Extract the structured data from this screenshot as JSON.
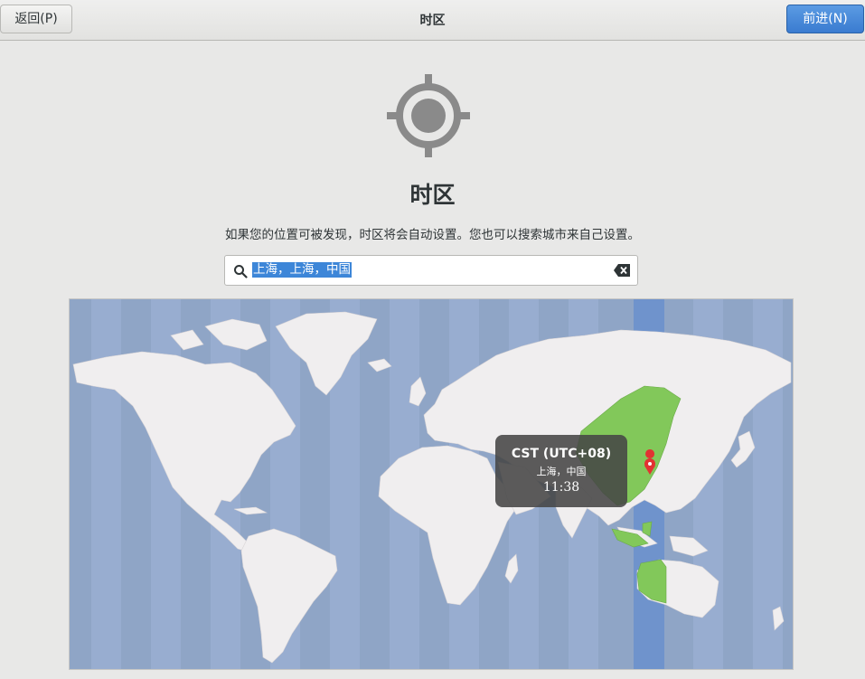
{
  "header": {
    "back_label": "返回(P)",
    "title": "时区",
    "next_label": "前进(N)"
  },
  "main": {
    "title": "时区",
    "description": "如果您的位置可被发现，时区将会自动设置。您也可以搜索城市来自己设置。",
    "search": {
      "value": "上海，上海，中国"
    }
  },
  "map": {
    "selected_timezone": "CST (UTC+08)",
    "location": "上海，中国",
    "time": "11:38",
    "colors": {
      "ocean": "#8fa5c6",
      "land": "#f0eeef",
      "highlight_zone": "#6f93cc",
      "selected_land": "#82c85a",
      "pin": "#e23232"
    }
  },
  "icons": [
    "location-crosshair-icon",
    "search-icon",
    "clear-icon",
    "map-pin-icon"
  ]
}
